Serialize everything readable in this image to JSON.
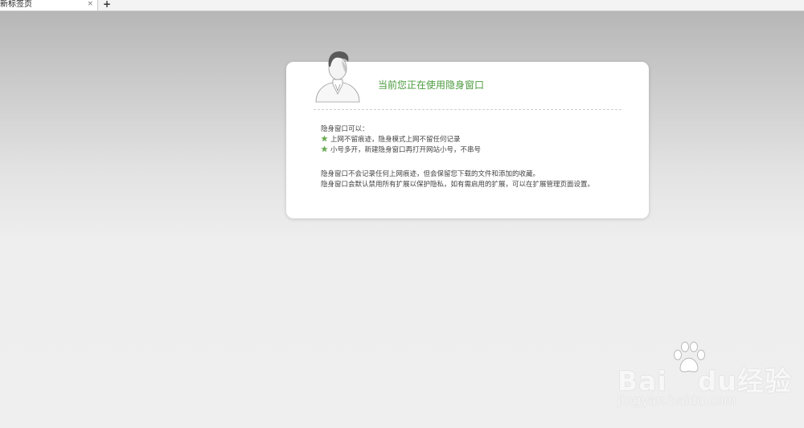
{
  "tab": {
    "title": "新标签页",
    "close_icon": "×",
    "new_tab_icon": "+"
  },
  "card": {
    "title": "当前您正在使用隐身窗口",
    "can_do_heading": "隐身窗口可以：",
    "features": [
      "上网不留痕迹，隐身模式上网不留任何记录",
      "小号多开，新建隐身窗口再打开网站小号，不串号"
    ],
    "notes": [
      "隐身窗口不会记录任何上网痕迹，但会保留您下载的文件和添加的收藏。",
      "隐身窗口会默认禁用所有扩展以保护隐私，如有需启用的扩展，可以在扩展管理页面设置。"
    ]
  },
  "watermark": {
    "logo_text": "Bai",
    "logo_text_2": "du",
    "logo_cn": "经验",
    "url": "jingyan.baidu.com"
  },
  "colors": {
    "title_green": "#4a9a3c",
    "star_green": "#6aac55"
  }
}
